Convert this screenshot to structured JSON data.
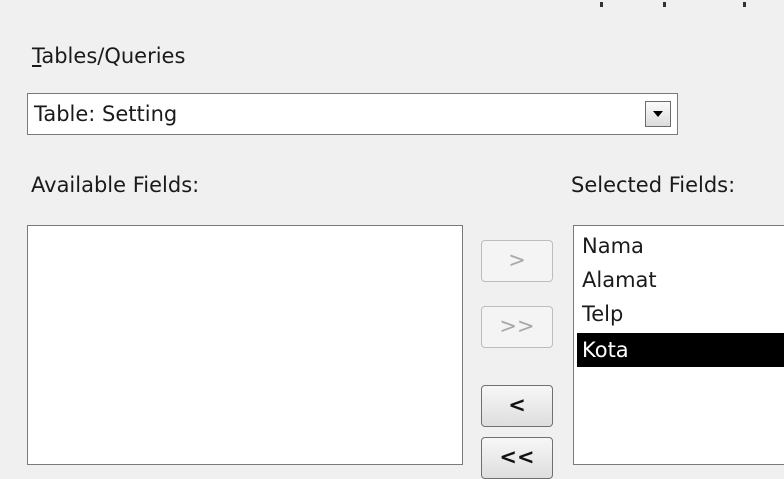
{
  "tables_queries": {
    "label_accesskey": "T",
    "label_rest": "ables/Queries",
    "selected_value": "Table: Setting"
  },
  "available_fields": {
    "label": "Available Fields:",
    "items": []
  },
  "selected_fields": {
    "label": "Selected Fields:",
    "items": [
      "Nama",
      "Alamat",
      "Telp",
      "Kota"
    ],
    "highlighted": "Kota"
  },
  "buttons": {
    "add": ">",
    "add_all": ">>",
    "remove": "<",
    "remove_all": "<<"
  },
  "icons": {
    "dropdown": "chevron-down-icon"
  }
}
